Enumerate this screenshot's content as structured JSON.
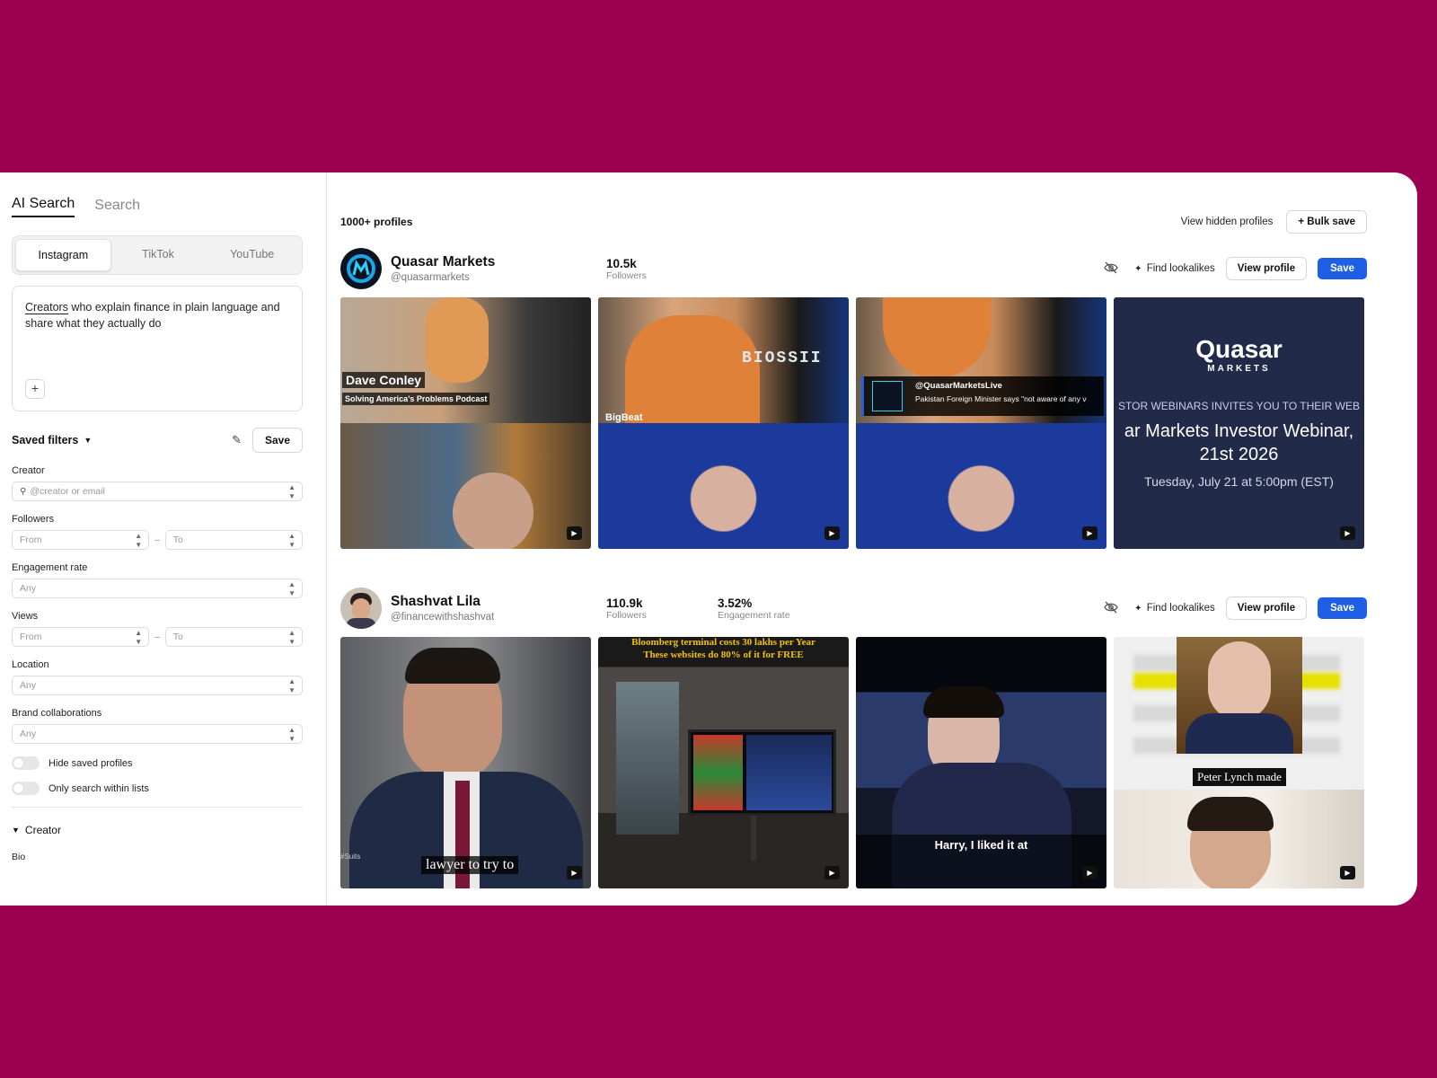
{
  "sidebar": {
    "tabs": [
      "AI Search",
      "Search"
    ],
    "platforms": [
      "Instagram",
      "TikTok",
      "YouTube"
    ],
    "prompt_underlined": "Creators",
    "prompt_rest": " who explain finance in plain language and share what they actually do",
    "plus": "+",
    "saved_filters": "Saved filters",
    "save_label": "Save",
    "creator_label": "Creator",
    "creator_placeholder": "@creator or email",
    "followers_label": "Followers",
    "from": "From",
    "to": "To",
    "dash": "–",
    "engagement_label": "Engagement rate",
    "any": "Any",
    "views_label": "Views",
    "location_label": "Location",
    "brand_label": "Brand collaborations",
    "toggle_hide": "Hide saved profiles",
    "toggle_lists": "Only search within lists",
    "section_creator": "Creator",
    "bio_label": "Bio"
  },
  "main": {
    "count": "1000+ profiles",
    "view_hidden": "View hidden profiles",
    "bulk_save": "+ Bulk save",
    "find_lookalikes": "Find lookalikes",
    "view_profile": "View profile",
    "save": "Save",
    "profiles": [
      {
        "name": "Quasar Markets",
        "handle": "@quasarmarkets",
        "followers": "10.5k",
        "followers_label": "Followers",
        "tiles": {
          "t1_name": "Dave Conley",
          "t1_sub": "Solving America's Problems Podcast",
          "t2_text": "BIOSSII",
          "t2_bar": "BigBeat",
          "t3_handle": "@QuasarMarketsLive",
          "t3_news": "Pakistan Foreign Minister says \"not aware of any v",
          "t4_brand": "Quasar",
          "t4_brand_sub": "MARKETS",
          "t4_line1": "STOR WEBINARS INVITES YOU TO THEIR WEB",
          "t4_line2": "ar Markets Investor Webinar,",
          "t4_line3": "21st 2026",
          "t4_line4": "Tuesday, July 21 at  5:00pm (EST)"
        }
      },
      {
        "name": "Shashvat Lila",
        "handle": "@financewithshashvat",
        "followers": "110.9k",
        "followers_label": "Followers",
        "engagement": "3.52%",
        "engagement_label": "Engagement rate",
        "tiles": {
          "t1_caption": "lawyer to try to",
          "t1_tag": "#Suits",
          "t2_line1": "Bloomberg terminal costs 30 lakhs per Year",
          "t2_line2": "These websites do 80% of it for FREE",
          "t3_caption": "Harry, I liked it at",
          "t4_caption": "Peter Lynch made"
        }
      }
    ]
  }
}
